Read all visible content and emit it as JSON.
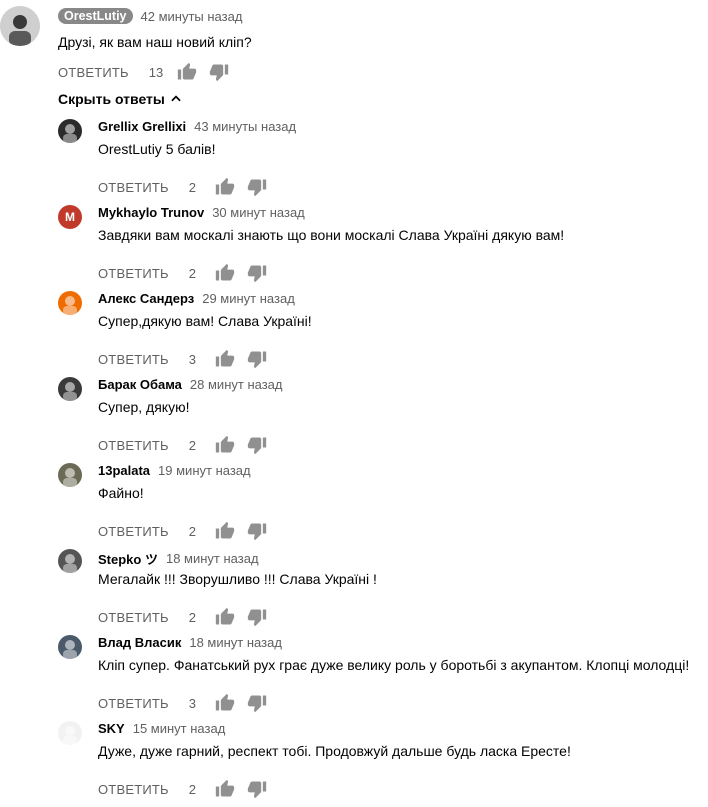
{
  "main_comment": {
    "author": "OrestLutiy",
    "time": "42 минуты назад",
    "text": "Друзі, як вам наш новий кліп?",
    "reply_label": "ОТВЕТИТЬ",
    "likes": "13"
  },
  "hide_replies_label": "Скрыть ответы",
  "replies": [
    {
      "author": "Grellix Grellixi",
      "time": "43 минуты назад",
      "text": "OrestLutiy 5 балів!",
      "reply_label": "ОТВЕТИТЬ",
      "likes": "2",
      "avatar_color": "#2b2b2b"
    },
    {
      "author": "Mykhaylo Trunov",
      "time": "30 минут назад",
      "text": "Завдяки вам москалі знають що вони москалі Слава Україні дякую вам!",
      "reply_label": "ОТВЕТИТЬ",
      "likes": "2",
      "avatar_color": "#c0392b",
      "avatar_letter": "M"
    },
    {
      "author": "Алекс Сандерз",
      "time": "29 минут назад",
      "text": "Супер,дякую вам! Слава Україні!",
      "reply_label": "ОТВЕТИТЬ",
      "likes": "3",
      "avatar_color": "#ef6c00"
    },
    {
      "author": "Барак Обама",
      "time": "28 минут назад",
      "text": "Супер, дякую!",
      "reply_label": "ОТВЕТИТЬ",
      "likes": "2",
      "avatar_color": "#3a3a3a"
    },
    {
      "author": "13palata",
      "time": "19 минут назад",
      "text": "Файно!",
      "reply_label": "ОТВЕТИТЬ",
      "likes": "2",
      "avatar_color": "#6b6b55"
    },
    {
      "author": "Stepko ツ",
      "time": "18 минут назад",
      "text": "Мегалайк !!! Зворушливо !!! Слава Україні !",
      "reply_label": "ОТВЕТИТЬ",
      "likes": "2",
      "avatar_color": "#555555"
    },
    {
      "author": "Влад Власик",
      "time": "18 минут назад",
      "text": "Кліп супер. Фанатський рух грає дуже велику  роль у боротьбі  з акупантом. Клопці молодці!",
      "reply_label": "ОТВЕТИТЬ",
      "likes": "3",
      "avatar_color": "#4a5a6a"
    },
    {
      "author": "SKY",
      "time": "15 минут назад",
      "text": "Дуже, дуже гарний, респект тобі. Продовжуй дальше будь ласка Ересте!",
      "reply_label": "ОТВЕТИТЬ",
      "likes": "2",
      "avatar_color": "#f2f2f2"
    }
  ]
}
